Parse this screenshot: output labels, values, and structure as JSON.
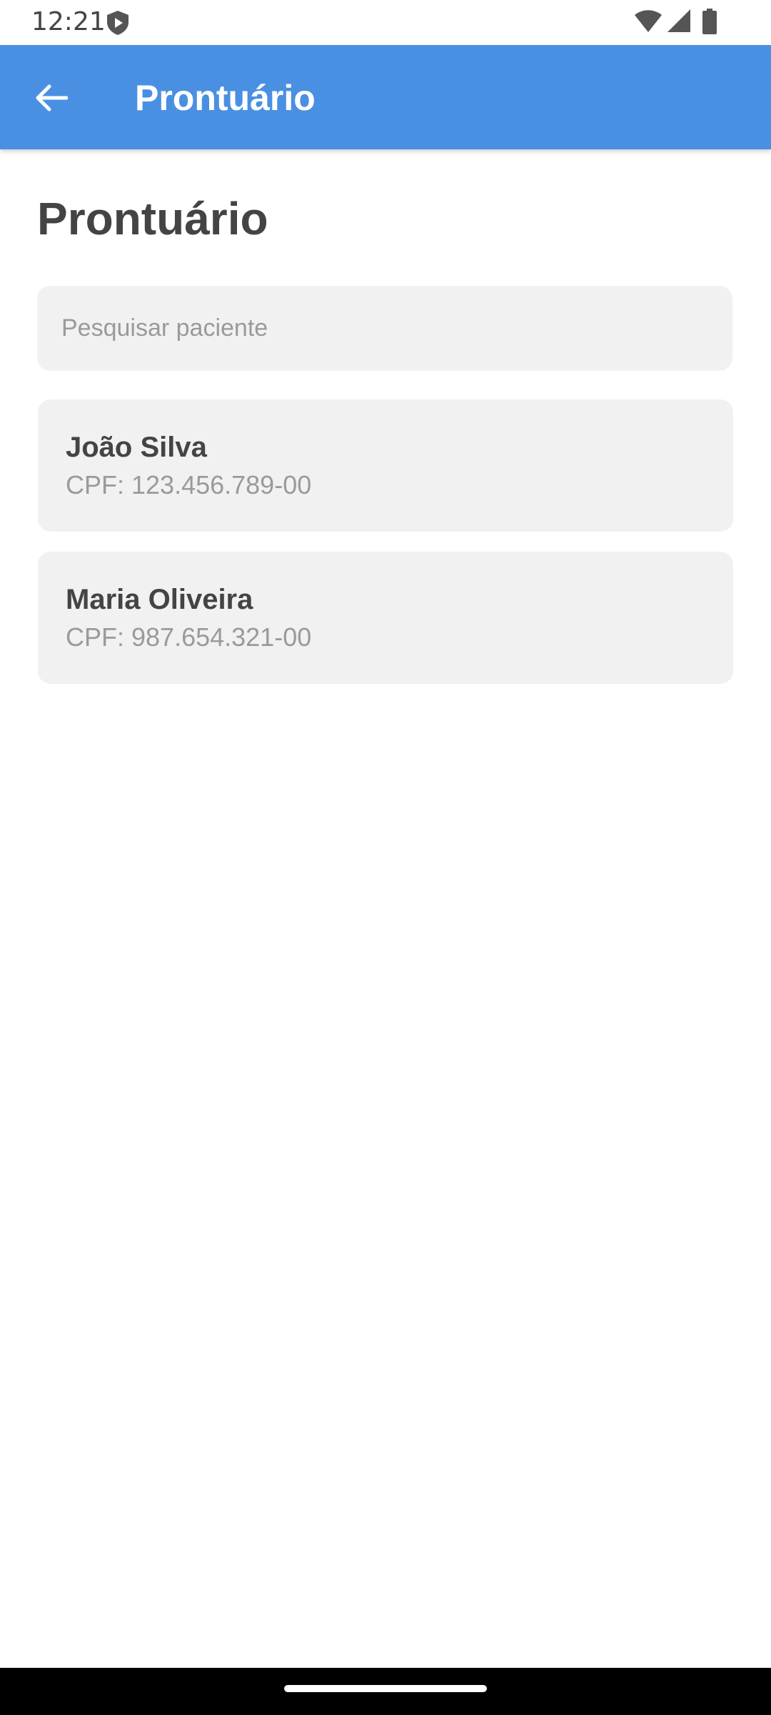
{
  "status_bar": {
    "time": "12:21",
    "icons": [
      "shield-icon",
      "wifi-icon",
      "signal-icon",
      "battery-icon"
    ]
  },
  "app_bar": {
    "title": "Prontuário",
    "back_icon": "arrow-back-icon",
    "background_color": "#4A90E2"
  },
  "main": {
    "title": "Prontuário",
    "search": {
      "placeholder": "Pesquisar paciente",
      "value": ""
    },
    "patients": [
      {
        "name": "João Silva",
        "cpf": "CPF: 123.456.789-00"
      },
      {
        "name": "Maria Oliveira",
        "cpf": "CPF: 987.654.321-00"
      }
    ]
  },
  "colors": {
    "text_primary": "#444444",
    "text_secondary": "#9A9A9A",
    "card_background": "#F1F1F1"
  }
}
